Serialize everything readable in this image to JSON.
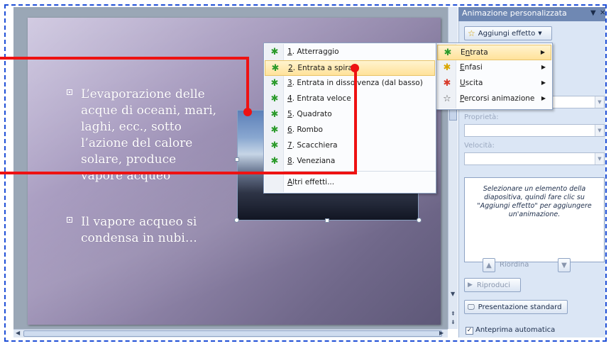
{
  "slide": {
    "bullet1": [
      "L’evaporazione delle",
      "acque di oceani, mari,",
      "laghi, ecc., sotto",
      "l’azione del calore",
      "solare, produce",
      "vapore acqueo"
    ],
    "bullet2": [
      "Il vapore acqueo si",
      "condensa in nubi…"
    ]
  },
  "entrance_menu": {
    "items": [
      {
        "num": "1",
        "rest": ". Atterraggio",
        "icon": "green-star-icon"
      },
      {
        "num": "2",
        "rest": ". Entrata a spirale",
        "icon": "green-star-icon"
      },
      {
        "num": "3",
        "rest": ". Entrata in dissolvenza (dal basso)",
        "icon": "green-star-icon"
      },
      {
        "num": "4",
        "rest": ". Entrata veloce",
        "icon": "green-star-icon"
      },
      {
        "num": "5",
        "rest": ". Quadrato",
        "icon": "green-star-icon"
      },
      {
        "num": "6",
        "rest": ". Rombo",
        "icon": "green-star-icon"
      },
      {
        "num": "7",
        "rest": ". Scacchiera",
        "icon": "green-star-icon"
      },
      {
        "num": "8",
        "rest": ". Veneziana",
        "icon": "green-star-icon"
      }
    ],
    "more_u": "A",
    "more_rest": "ltri effetti..."
  },
  "effect_menu": {
    "items": [
      {
        "u": "n",
        "pre": "E",
        "post": "trata",
        "icon": "entrance-icon"
      },
      {
        "u": "E",
        "pre": "",
        "post": "nfasi",
        "icon": "emphasis-icon"
      },
      {
        "u": "U",
        "pre": "",
        "post": "scita",
        "icon": "exit-icon"
      },
      {
        "u": "P",
        "pre": "",
        "post": "ercorsi animazione",
        "icon": "motion-path-icon"
      }
    ]
  },
  "task_pane": {
    "title": "Animazione personalizzata",
    "add_effect": "Aggiungi effetto",
    "properties_label": "Proprietà:",
    "speed_label": "Velocità:",
    "hint": "Selezionare un elemento della diapositiva, quindi fare clic su \"Aggiungi effetto\" per aggiungere un'animazione.",
    "reorder": "Riordina",
    "play": "Riproduci",
    "slideshow": "Presentazione standard",
    "autopreview": "Anteprima automatica"
  },
  "colors": {
    "annotation": "#ee1212",
    "selected_item": "#ffe29a"
  }
}
